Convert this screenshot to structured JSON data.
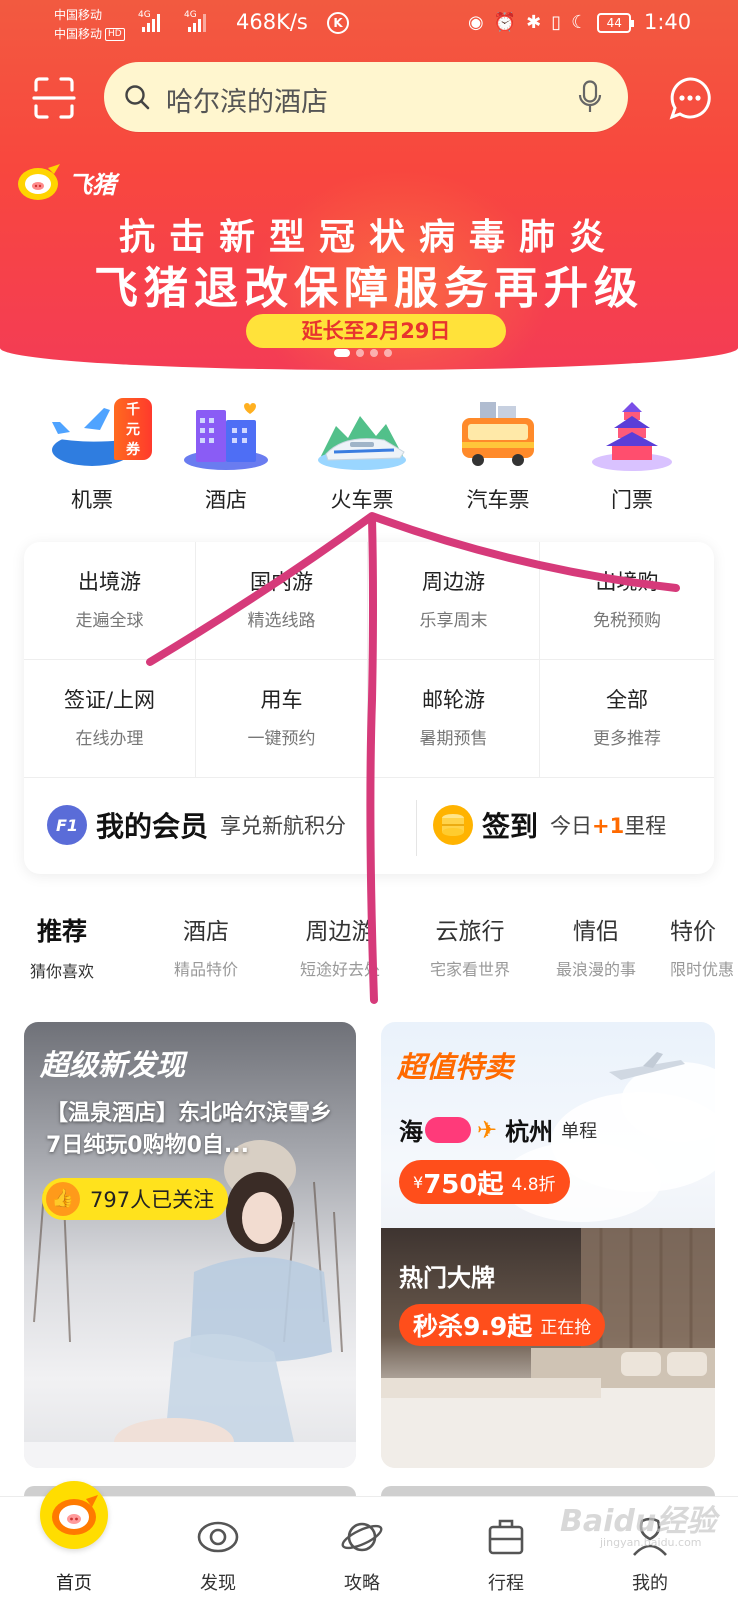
{
  "status_bar": {
    "carrier_1": "中国移动",
    "carrier_2": "中国移动",
    "hd_badge": "HD",
    "network_1": "4G",
    "network_2": "4G",
    "net_speed": "468K/s",
    "battery_level": "44",
    "time": "1:40"
  },
  "header": {
    "search_placeholder": "哈尔滨的酒店"
  },
  "banner": {
    "brand_name": "飞猪",
    "line1": "抗击新型冠状病毒肺炎",
    "line2": "飞猪退改保障服务再升级",
    "pill": "延长至2月29日",
    "page_count": 4,
    "active_page": 0
  },
  "main_categories": [
    {
      "label": "机票",
      "icon": "plane-icon",
      "badge": "千元券"
    },
    {
      "label": "酒店",
      "icon": "hotel-icon"
    },
    {
      "label": "火车票",
      "icon": "train-icon"
    },
    {
      "label": "汽车票",
      "icon": "bus-icon"
    },
    {
      "label": "门票",
      "icon": "temple-icon"
    }
  ],
  "sub_categories": [
    {
      "title": "出境游",
      "subtitle": "走遍全球"
    },
    {
      "title": "国内游",
      "subtitle": "精选线路"
    },
    {
      "title": "周边游",
      "subtitle": "乐享周末"
    },
    {
      "title": "出境购",
      "subtitle": "免税预购"
    },
    {
      "title": "签证/上网",
      "subtitle": "在线办理"
    },
    {
      "title": "用车",
      "subtitle": "一键预约"
    },
    {
      "title": "邮轮游",
      "subtitle": "暑期预售"
    },
    {
      "title": "全部",
      "subtitle": "更多推荐"
    }
  ],
  "member": {
    "badge_text": "F1",
    "title": "我的会员",
    "subtitle": "享兑新航积分"
  },
  "checkin": {
    "title": "签到",
    "subtitle_prefix": "今日",
    "bonus": "+1",
    "subtitle_suffix": "里程"
  },
  "feed_tabs": [
    {
      "label": "推荐",
      "subtitle": "猜你喜欢",
      "active": true
    },
    {
      "label": "酒店",
      "subtitle": "精品特价"
    },
    {
      "label": "周边游",
      "subtitle": "短途好去处"
    },
    {
      "label": "云旅行",
      "subtitle": "宅家看世界"
    },
    {
      "label": "情侣",
      "subtitle": "最浪漫的事"
    },
    {
      "label": "特价",
      "subtitle": "限时优惠"
    }
  ],
  "feed_left": {
    "tag": "超级新发现",
    "description": "【温泉酒店】东北哈尔滨雪乡 7日纯玩0购物0自...",
    "follow_count": "797人已关注"
  },
  "feed_right_top": {
    "tag": "超值特卖",
    "origin_visible": "海",
    "destination": "杭州",
    "trip_type": "单程",
    "currency": "¥",
    "price": "750起",
    "discount": "4.8折"
  },
  "feed_right_bottom": {
    "tag": "热门大牌",
    "deal": "秒杀9.9起",
    "status": "正在抢"
  },
  "bottom_nav": [
    {
      "label": "首页",
      "icon": "pig-home-icon",
      "active": true
    },
    {
      "label": "发现",
      "icon": "eye-icon"
    },
    {
      "label": "攻略",
      "icon": "planet-icon"
    },
    {
      "label": "行程",
      "icon": "suitcase-icon"
    },
    {
      "label": "我的",
      "icon": "profile-icon"
    }
  ],
  "watermark": {
    "text": "Baidu经验",
    "sub": "jingyan.baidu.com"
  },
  "colors": {
    "banner_red": "#f8473e",
    "search_bg": "#fff6cf",
    "accent_orange": "#ff6a00",
    "price_red": "#ff4e1b",
    "annotation_pink": "#d63a7a",
    "highlight_yellow": "#ffe21d"
  }
}
